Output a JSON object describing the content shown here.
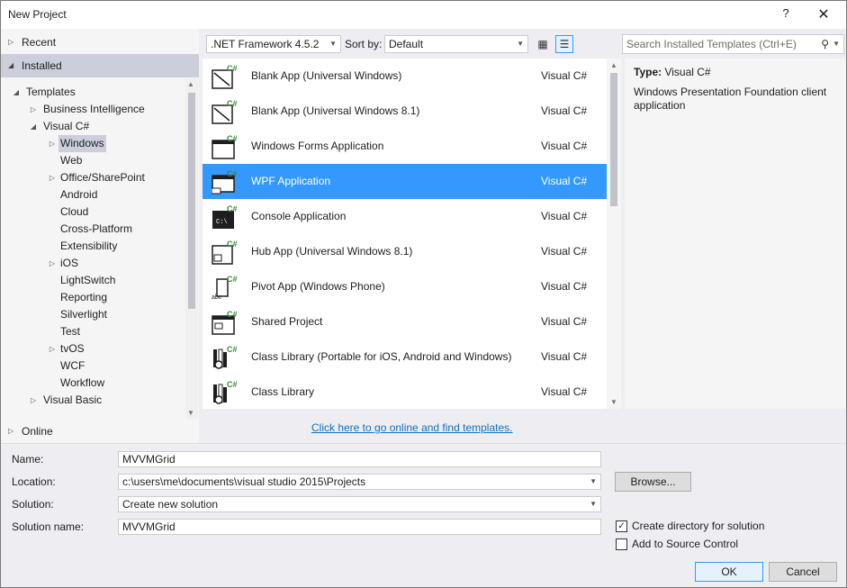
{
  "window": {
    "title": "New Project",
    "help_glyph": "?",
    "close_glyph": "✕"
  },
  "left_pane": {
    "recent": "Recent",
    "installed": "Installed",
    "online": "Online",
    "tree": [
      {
        "label": "Templates"
      },
      {
        "label": "Business Intelligence"
      },
      {
        "label": "Visual C#"
      },
      {
        "label": "Windows"
      },
      {
        "label": "Web"
      },
      {
        "label": "Office/SharePoint"
      },
      {
        "label": "Android"
      },
      {
        "label": "Cloud"
      },
      {
        "label": "Cross-Platform"
      },
      {
        "label": "Extensibility"
      },
      {
        "label": "iOS"
      },
      {
        "label": "LightSwitch"
      },
      {
        "label": "Reporting"
      },
      {
        "label": "Silverlight"
      },
      {
        "label": "Test"
      },
      {
        "label": "tvOS"
      },
      {
        "label": "WCF"
      },
      {
        "label": "Workflow"
      },
      {
        "label": "Visual Basic"
      }
    ]
  },
  "toolbar": {
    "framework": ".NET Framework 4.5.2",
    "sort_label": "Sort by:",
    "sort_value": "Default",
    "search_placeholder": "Search Installed Templates (Ctrl+E)"
  },
  "templates": [
    {
      "name": "Blank App (Universal Windows)",
      "lang": "Visual C#",
      "icon": "blank-app-icon"
    },
    {
      "name": "Blank App (Universal Windows 8.1)",
      "lang": "Visual C#",
      "icon": "blank-app-icon"
    },
    {
      "name": "Windows Forms Application",
      "lang": "Visual C#",
      "icon": "winforms-icon"
    },
    {
      "name": "WPF Application",
      "lang": "Visual C#",
      "icon": "wpf-icon"
    },
    {
      "name": "Console Application",
      "lang": "Visual C#",
      "icon": "console-icon"
    },
    {
      "name": "Hub App (Universal Windows 8.1)",
      "lang": "Visual C#",
      "icon": "hub-app-icon"
    },
    {
      "name": "Pivot App (Windows Phone)",
      "lang": "Visual C#",
      "icon": "pivot-app-icon"
    },
    {
      "name": "Shared Project",
      "lang": "Visual C#",
      "icon": "shared-project-icon"
    },
    {
      "name": "Class Library (Portable for iOS, Android and Windows)",
      "lang": "Visual C#",
      "icon": "class-library-icon"
    },
    {
      "name": "Class Library",
      "lang": "Visual C#",
      "icon": "class-library-icon"
    }
  ],
  "description": {
    "type_label": "Type:",
    "type_value": "Visual C#",
    "text": "Windows Presentation Foundation client application"
  },
  "online_link": "Click here to go online and find templates.",
  "form": {
    "name_label": "Name:",
    "name_value": "MVVMGrid",
    "location_label": "Location:",
    "location_value": "c:\\users\\me\\documents\\visual studio 2015\\Projects",
    "solution_label": "Solution:",
    "solution_value": "Create new solution",
    "solution_name_label": "Solution name:",
    "solution_name_value": "MVVMGrid",
    "browse": "Browse...",
    "create_dir": "Create directory for solution",
    "add_source": "Add to Source Control",
    "ok": "OK",
    "cancel": "Cancel"
  },
  "colors": {
    "selection": "#3399ff",
    "link": "#0e70c0",
    "csharp_badge": "#388a34"
  }
}
